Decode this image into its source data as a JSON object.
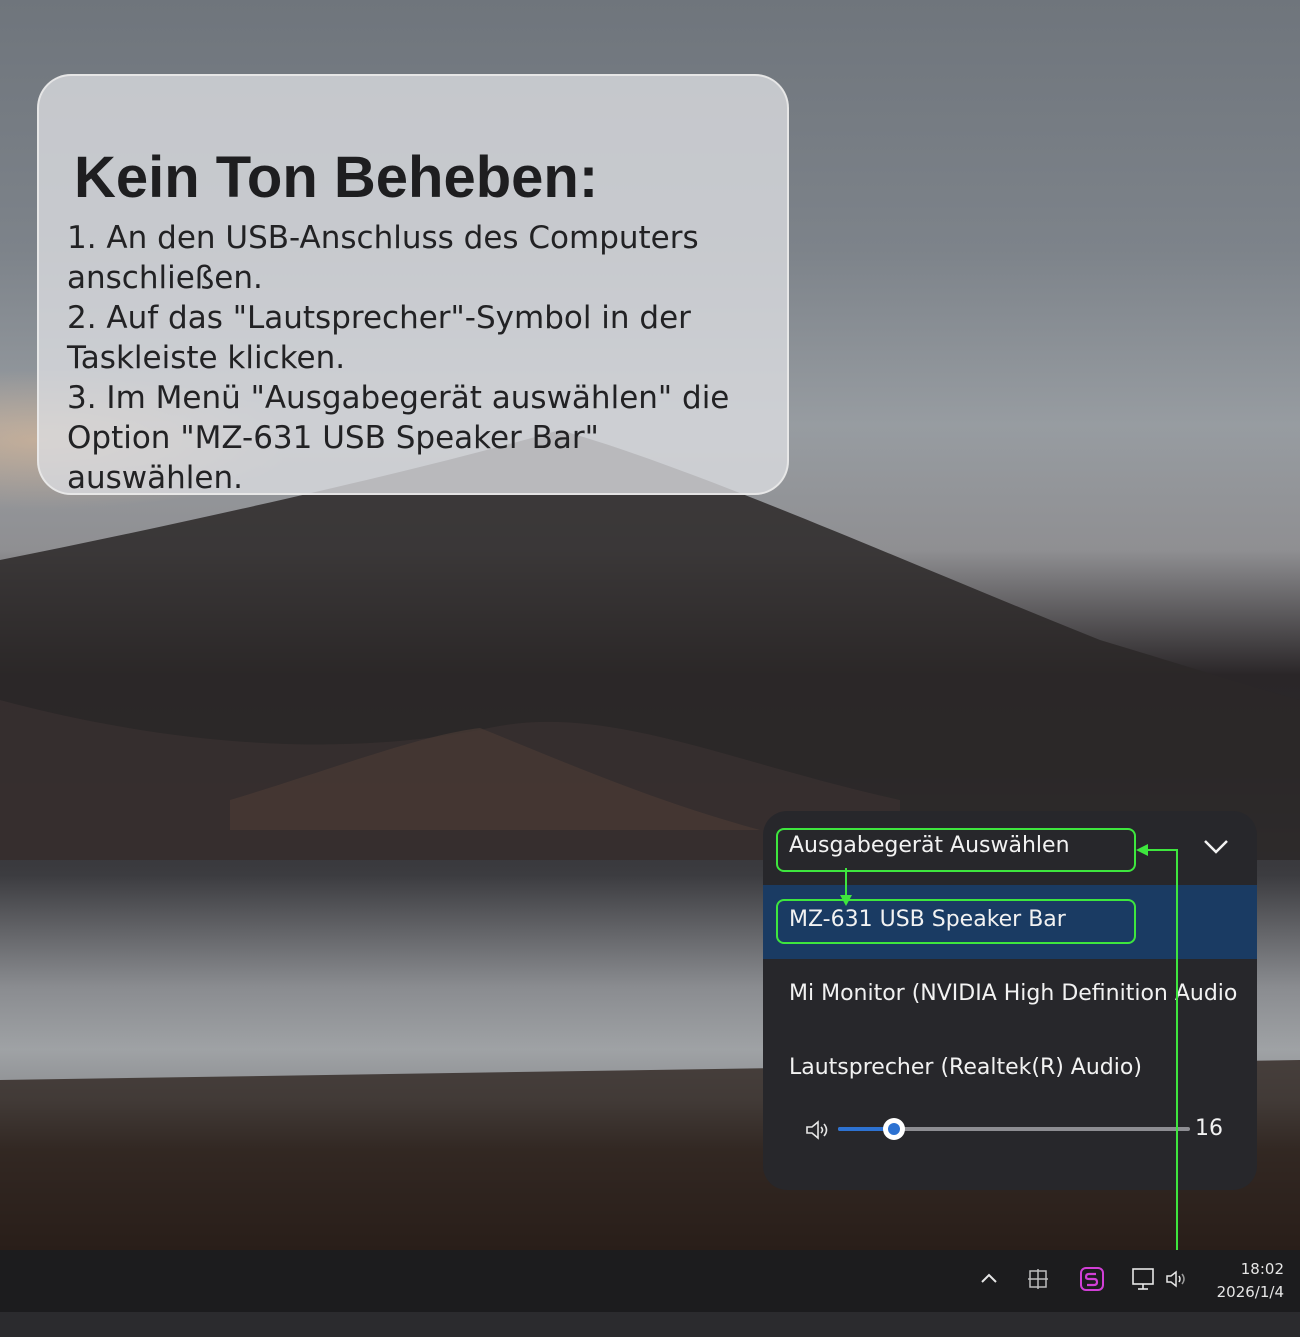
{
  "info_card": {
    "title": "Kein Ton Beheben:",
    "steps": [
      "1. An den USB-Anschluss des Computers anschließen.",
      "2. Auf das \"Lautsprecher\"-Symbol in der Taskleiste klicken.",
      "3. Im Menü \"Ausgabegerät auswählen\" die Option \"MZ-631 USB Speaker Bar\" auswählen."
    ]
  },
  "flyout": {
    "header": "Ausgabegerät Auswählen",
    "devices": [
      {
        "label": "MZ-631 USB Speaker Bar",
        "selected": true
      },
      {
        "label": "Mi Monitor (NVIDIA High Definition Audio",
        "selected": false
      },
      {
        "label": "Lautsprecher (Realtek(R) Audio)",
        "selected": false
      }
    ],
    "volume": {
      "value": "16",
      "level": 0.16
    }
  },
  "taskbar": {
    "time": "18:02",
    "date": "2026/1/4",
    "tray_icons": [
      "chevron-up-icon",
      "input-method-icon",
      "app-s-icon",
      "network-monitor-icon",
      "speaker-icon"
    ]
  },
  "colors": {
    "highlight": "#3ee63e",
    "selected_row": "#1a3b63",
    "flyout_bg": "#27272b",
    "accent": "#2d72d2"
  }
}
